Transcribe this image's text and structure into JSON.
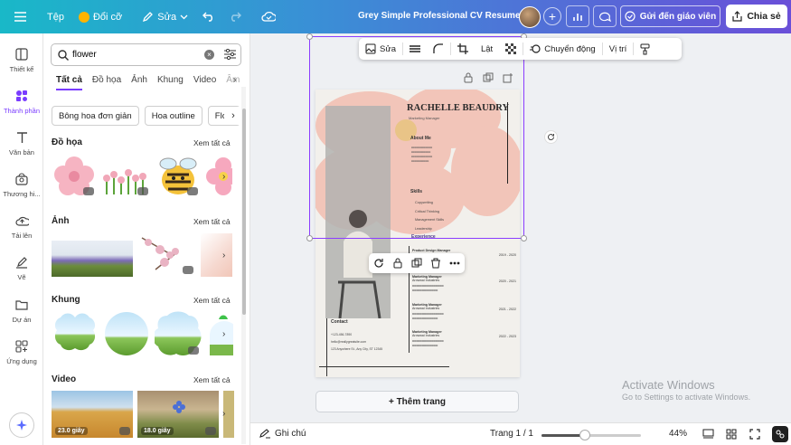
{
  "topbar": {
    "file_label": "Tệp",
    "resize_label": "Đổi cỡ",
    "edit_label": "Sửa",
    "doc_title": "Grey Simple Professional CV Resume",
    "gift_label": "Gửi đến giáo viên",
    "share_label": "Chia sẻ"
  },
  "rail": {
    "items": [
      {
        "label": "Thiết kế",
        "icon": "layout-icon"
      },
      {
        "label": "Thành phần",
        "icon": "elements-icon",
        "active": true
      },
      {
        "label": "Văn bản",
        "icon": "text-icon"
      },
      {
        "label": "Thương hi...",
        "icon": "brand-icon"
      },
      {
        "label": "Tải lên",
        "icon": "upload-icon"
      },
      {
        "label": "Vẽ",
        "icon": "draw-icon"
      },
      {
        "label": "Dự án",
        "icon": "folder-icon"
      },
      {
        "label": "Ứng dụng",
        "icon": "apps-icon"
      }
    ]
  },
  "panel": {
    "search_value": "flower",
    "tabs": [
      "Tất cả",
      "Đồ họa",
      "Ảnh",
      "Khung",
      "Video",
      "Âm"
    ],
    "chips": [
      "Bông hoa đơn giản",
      "Hoa outline",
      "Flow"
    ],
    "sections": {
      "graphics": {
        "title": "Đồ họa",
        "see_all": "Xem tất cả"
      },
      "photos": {
        "title": "Ảnh",
        "see_all": "Xem tất cả"
      },
      "frames": {
        "title": "Khung",
        "see_all": "Xem tất cả"
      },
      "videos": {
        "title": "Video",
        "see_all": "Xem tất cả",
        "durations": [
          "23.0 giây",
          "18.0 giây"
        ]
      }
    }
  },
  "context_toolbar": {
    "edit": "Sửa",
    "crop": "Lật",
    "animate": "Chuyển động",
    "position": "Vị trí"
  },
  "resume": {
    "name": "RACHELLE BEAUDRY",
    "role": "Marketing Manager",
    "about": "About Me",
    "skills_title": "Skills",
    "skills": [
      "Copywriting",
      "Critical Thinking",
      "Management Skills",
      "Leadership"
    ],
    "experience_title": "Experience",
    "jobs": [
      {
        "title": "Product Design Manager",
        "org": "Arowwai Industries",
        "dates": "2019 - 2020"
      },
      {
        "title": "Marketing Manager",
        "org": "Arowwai Industries",
        "dates": "2020 - 2021"
      },
      {
        "title": "Marketing Manager",
        "org": "Arowwai Industries",
        "dates": "2021 - 2022"
      },
      {
        "title": "Marketing Manager",
        "org": "Arowwai Industries",
        "dates": "2022 - 2023"
      }
    ],
    "contact_title": "Contact",
    "contact": [
      "+123-456-7890",
      "hello@reallygreatsite.com",
      "123 Anywhere St., Any City, ST 12345"
    ]
  },
  "canvas": {
    "add_page": "+ Thêm trang"
  },
  "watermark": {
    "line1": "Activate Windows",
    "line2": "Go to Settings to activate Windows."
  },
  "bottombar": {
    "notes": "Ghi chú",
    "page": "Trang 1 / 1",
    "zoom": "44%",
    "zoom_fraction": 0.44
  },
  "colors": {
    "accent": "#8b3dff",
    "topbar_start": "#19b8c8",
    "topbar_end": "#6a4fd8"
  }
}
